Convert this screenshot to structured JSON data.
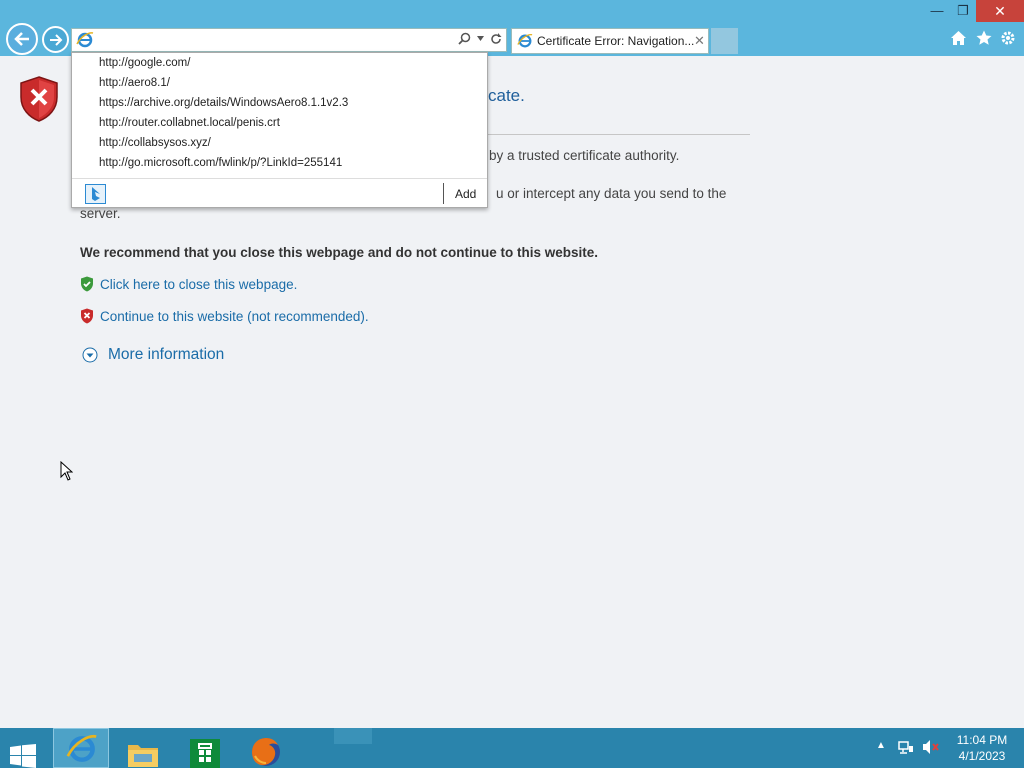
{
  "browser": {
    "tab_title": "Certificate Error: Navigation...",
    "address_value": "",
    "window_controls": {
      "minimize": "—",
      "maximize": "❐",
      "close": "✕"
    }
  },
  "autocomplete": {
    "items": [
      "http://google.com/",
      "http://aero8.1/",
      "https://archive.org/details/WindowsAero8.1.1v2.3",
      "http://router.collabnet.local/penis.crt",
      "http://collabsysos.xyz/",
      "http://go.microsoft.com/fwlink/p/?LinkId=255141"
    ],
    "add_label": "Add"
  },
  "page": {
    "heading_visible": "cate.",
    "para1_visible": "by a trusted certificate authority.",
    "para2_visible_line1": "u or intercept any data you send to the",
    "para2_visible_line2": "server.",
    "recommendation": "We recommend that you close this webpage and do not continue to this website.",
    "close_link": "Click here to close this webpage.",
    "continue_link": "Continue to this website (not recommended).",
    "more_info": "More information"
  },
  "taskbar": {
    "clock_time": "11:04 PM",
    "clock_date": "4/1/2023",
    "apps": [
      "start-icon",
      "internet-explorer-icon",
      "file-explorer-icon",
      "store-icon",
      "firefox-icon"
    ]
  },
  "colors": {
    "chrome_blue": "#5bb6dd",
    "taskbar_blue": "#2a84ac",
    "link_blue": "#1a6ca8",
    "close_red": "#c7433b"
  }
}
